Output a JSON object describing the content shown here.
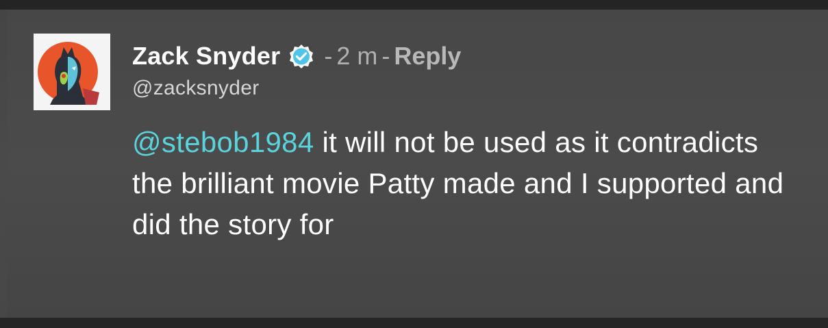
{
  "comment": {
    "author_name": "Zack Snyder",
    "verified_icon": "verified-check-icon",
    "sep1": "-",
    "time": "2 m",
    "sep2": "-",
    "reply_label": "Reply",
    "handle": "@zacksnyder",
    "mention": "@stebob1984",
    "body_text": " it will not be used as it contradicts the brilliant movie Patty made and I supported and did the story for"
  },
  "colors": {
    "mention": "#5ad3dc",
    "verified": "#4fc3e8",
    "background": "#4a4a4a"
  }
}
